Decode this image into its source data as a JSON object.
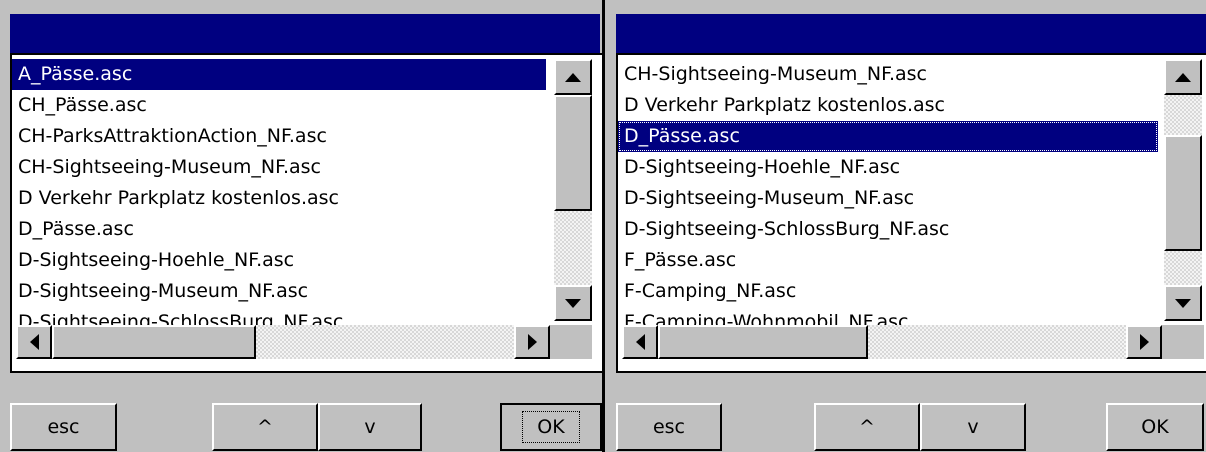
{
  "left_dialog": {
    "items": [
      "A_Pässe.asc",
      "CH_Pässe.asc",
      "CH-ParksAttraktionAction_NF.asc",
      "CH-Sightseeing-Museum_NF.asc",
      "D Verkehr Parkplatz kostenlos.asc",
      "D_Pässe.asc",
      "D-Sightseeing-Hoehle_NF.asc",
      "D-Sightseeing-Museum_NF.asc",
      "D-Sightseeing-SchlossBurg_NF.asc"
    ],
    "selected_index": 0,
    "buttons": {
      "esc": "esc",
      "up": "^",
      "down": "v",
      "ok": "OK"
    }
  },
  "right_dialog": {
    "items": [
      "CH-Sightseeing-Museum_NF.asc",
      "D Verkehr Parkplatz kostenlos.asc",
      "D_Pässe.asc",
      "D-Sightseeing-Hoehle_NF.asc",
      "D-Sightseeing-Museum_NF.asc",
      "D-Sightseeing-SchlossBurg_NF.asc",
      "F_Pässe.asc",
      "F-Camping_NF.asc",
      "F-Camping-Wohnmobil_NF.asc"
    ],
    "selected_index": 2,
    "buttons": {
      "esc": "esc",
      "up": "^",
      "down": "v",
      "ok": "OK"
    }
  },
  "colors": {
    "titlebar": "#000080",
    "selection": "#000080",
    "face": "#c0c0c0",
    "list_background": "#ffffff"
  }
}
